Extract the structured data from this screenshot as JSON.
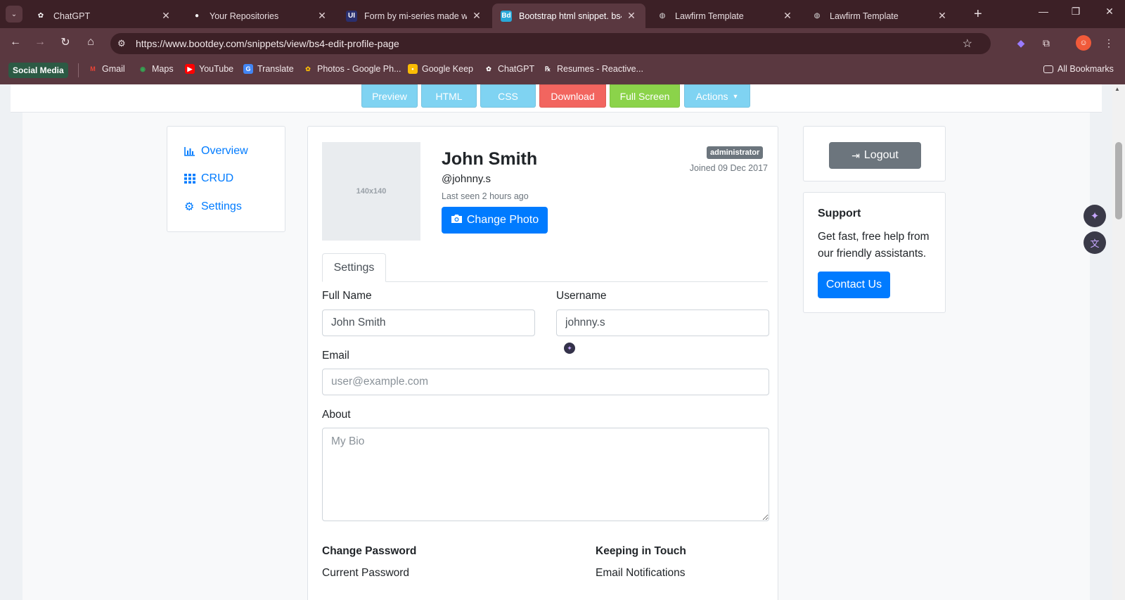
{
  "browser": {
    "tabs": [
      {
        "label": "ChatGPT",
        "icon": "chatgpt-icon"
      },
      {
        "label": "Your Repositories",
        "icon": "github-icon"
      },
      {
        "label": "Form by mi-series made with",
        "icon": "ui-icon"
      },
      {
        "label": "Bootstrap html snippet. bs4",
        "icon": "bootdey-icon",
        "active": true
      },
      {
        "label": "Lawfirm Template",
        "icon": "globe-icon"
      },
      {
        "label": "Lawfirm Template",
        "icon": "globe-icon"
      }
    ],
    "url": "https://www.bootdey.com/snippets/view/bs4-edit-profile-page",
    "bookmarks": {
      "pill": "Social Media",
      "items": [
        "Gmail",
        "Maps",
        "YouTube",
        "Translate",
        "Photos - Google Ph...",
        "Google Keep",
        "ChatGPT",
        "Resumes - Reactive..."
      ],
      "all": "All Bookmarks"
    }
  },
  "snippet_toolbar": {
    "preview": "Preview",
    "html": "HTML",
    "css": "CSS",
    "download": "Download",
    "fullscreen": "Full Screen",
    "actions": "Actions"
  },
  "sidebar": {
    "items": [
      {
        "label": "Overview",
        "icon": "bar-chart-icon"
      },
      {
        "label": "CRUD",
        "icon": "grid-icon"
      },
      {
        "label": "Settings",
        "icon": "gear-icon"
      }
    ]
  },
  "profile": {
    "photo_placeholder": "140x140",
    "name": "John Smith",
    "handle": "@johnny.s",
    "last_seen": "Last seen 2 hours ago",
    "change_photo": "Change Photo",
    "role_badge": "administrator",
    "joined": "Joined 09 Dec 2017"
  },
  "tabs": {
    "settings": "Settings"
  },
  "form": {
    "full_name_label": "Full Name",
    "full_name_value": "John Smith",
    "username_label": "Username",
    "username_value": "johnny.s",
    "email_label": "Email",
    "email_placeholder": "user@example.com",
    "about_label": "About",
    "about_placeholder": "My Bio",
    "change_password_title": "Change Password",
    "current_password_label": "Current Password",
    "keeping_in_touch_title": "Keeping in Touch",
    "email_notifications_label": "Email Notifications"
  },
  "right_panel": {
    "logout": "Logout",
    "support_title": "Support",
    "support_text": "Get fast, free help from our friendly assistants.",
    "contact_us": "Contact Us"
  },
  "colors": {
    "primary": "#007bff",
    "secondary": "#6c757d",
    "download": "#f2655f",
    "fullscreen": "#8bd34a",
    "toolbar_light_blue": "#7fd3f2"
  }
}
